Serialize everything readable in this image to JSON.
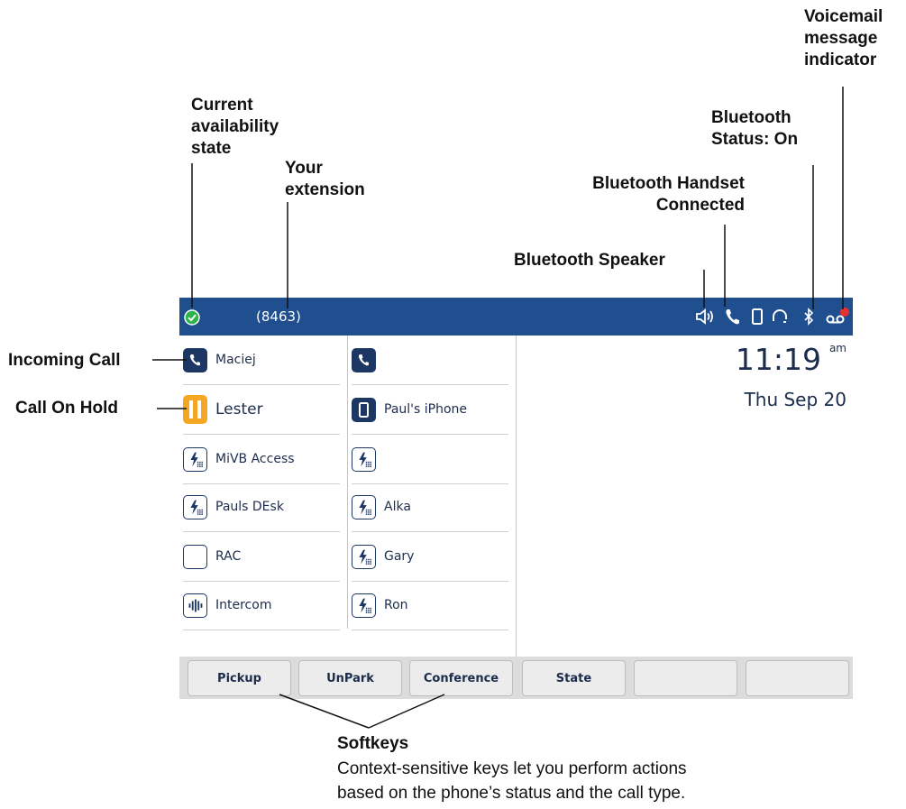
{
  "callouts": {
    "voicemail": "Voicemail\nmessage\nindicator",
    "availability": "Current\navailability\nstate",
    "bt_status": "Bluetooth\nStatus: On",
    "your_extension": "Your\nextension",
    "bt_handset": "Bluetooth Handset\nConnected",
    "bt_speaker": "Bluetooth Speaker",
    "incoming_call": "Incoming Call",
    "call_on_hold": "Call On Hold",
    "softkeys_title": "Softkeys",
    "softkeys_desc": "Context-sensitive keys let you perform actions\nbased on the phone’s status and the call type."
  },
  "phone": {
    "status_bar": {
      "extension": "(8463)",
      "icons": [
        "bluetooth-speaker-icon",
        "bluetooth-handset-icon",
        "mobile-phone-icon",
        "headset-icon",
        "bluetooth-icon",
        "voicemail-icon"
      ],
      "color": "#1f4f8e"
    },
    "keys_left": [
      {
        "label": "Maciej",
        "icon": "phone-icon"
      },
      {
        "label": "Lester",
        "icon": "hold-icon"
      },
      {
        "label": "MiVB Access",
        "icon": "speed-dial-icon"
      },
      {
        "label": "Pauls DEsk",
        "icon": "speed-dial-icon"
      },
      {
        "label": "RAC",
        "icon": "blank-key-icon"
      },
      {
        "label": "Intercom",
        "icon": "intercom-icon"
      }
    ],
    "keys_mid": [
      {
        "label": "",
        "icon": "phone-icon"
      },
      {
        "label": "Paul's iPhone",
        "icon": "mobile-phone-icon"
      },
      {
        "label": "",
        "icon": "speed-dial-icon"
      },
      {
        "label": "Alka",
        "icon": "speed-dial-icon"
      },
      {
        "label": "Gary",
        "icon": "speed-dial-icon"
      },
      {
        "label": "Ron",
        "icon": "speed-dial-icon"
      }
    ],
    "time": "11:19",
    "ampm": "am",
    "date": "Thu Sep 20",
    "softkeys": [
      "Pickup",
      "UnPark",
      "Conference",
      "State",
      "",
      ""
    ],
    "hold_color": "#f5a623",
    "call_icon_color": "#1c3763"
  }
}
